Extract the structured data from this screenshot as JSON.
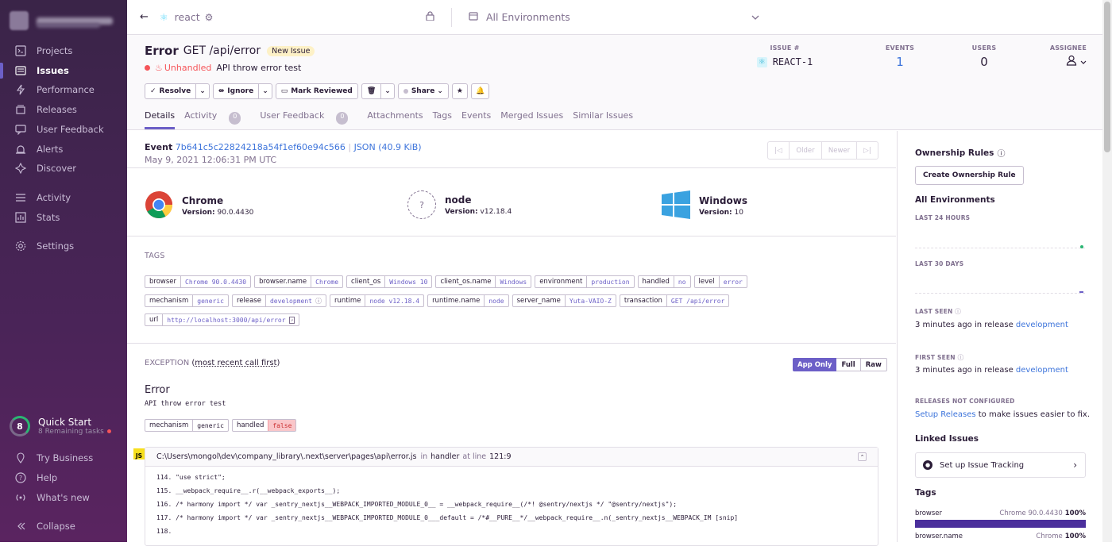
{
  "sidebar": {
    "items": [
      {
        "label": "Projects",
        "icon": "projects-icon"
      },
      {
        "label": "Issues",
        "icon": "issues-icon",
        "active": true
      },
      {
        "label": "Performance",
        "icon": "performance-icon"
      },
      {
        "label": "Releases",
        "icon": "releases-icon"
      },
      {
        "label": "User Feedback",
        "icon": "user-feedback-icon"
      },
      {
        "label": "Alerts",
        "icon": "alerts-icon"
      },
      {
        "label": "Discover",
        "icon": "discover-icon"
      },
      {
        "label": "Activity",
        "icon": "activity-icon"
      },
      {
        "label": "Stats",
        "icon": "stats-icon"
      },
      {
        "label": "Settings",
        "icon": "settings-icon"
      }
    ],
    "quick_start": {
      "count": "8",
      "title": "Quick Start",
      "subtitle": "8 Remaining tasks"
    },
    "bottom": [
      {
        "label": "Try Business"
      },
      {
        "label": "Help"
      },
      {
        "label": "What's new"
      },
      {
        "label": "Collapse"
      }
    ]
  },
  "topbar": {
    "project": "react",
    "environment": "All Environments"
  },
  "issue": {
    "level": "Error",
    "title": "GET /api/error",
    "badge": "New Issue",
    "unhandled": "Unhandled",
    "message": "API throw error test",
    "issue_label": "ISSUE #",
    "issue_id": "REACT-1",
    "events_label": "EVENTS",
    "events": "1",
    "users_label": "USERS",
    "users": "0",
    "assignee_label": "ASSIGNEE"
  },
  "actions": {
    "resolve": "Resolve",
    "ignore": "Ignore",
    "mark_reviewed": "Mark Reviewed",
    "share": "Share"
  },
  "tabs": {
    "details": "Details",
    "activity": "Activity",
    "activity_count": "0",
    "user_feedback": "User Feedback",
    "uf_count": "0",
    "attachments": "Attachments",
    "tags": "Tags",
    "events": "Events",
    "merged": "Merged Issues",
    "similar": "Similar Issues"
  },
  "event": {
    "label": "Event",
    "id": "7b641c5c22824218a54f1ef60e94c566",
    "json": "JSON (40.9 KiB)",
    "date": "May 9, 2021 12:06:31 PM UTC",
    "older": "Older",
    "newer": "Newer"
  },
  "contexts": [
    {
      "name": "Chrome",
      "version_label": "Version:",
      "version": "90.0.4430"
    },
    {
      "name": "node",
      "version_label": "Version:",
      "version": "v12.18.4"
    },
    {
      "name": "Windows",
      "version_label": "Version:",
      "version": "10"
    }
  ],
  "tags_title": "TAGS",
  "tags": [
    {
      "k": "browser",
      "v": "Chrome 90.0.4430"
    },
    {
      "k": "browser.name",
      "v": "Chrome"
    },
    {
      "k": "client_os",
      "v": "Windows 10"
    },
    {
      "k": "client_os.name",
      "v": "Windows"
    },
    {
      "k": "environment",
      "v": "production"
    },
    {
      "k": "handled",
      "v": "no"
    },
    {
      "k": "level",
      "v": "error"
    },
    {
      "k": "mechanism",
      "v": "generic"
    },
    {
      "k": "release",
      "v": "development"
    },
    {
      "k": "runtime",
      "v": "node v12.18.4"
    },
    {
      "k": "runtime.name",
      "v": "node"
    },
    {
      "k": "server_name",
      "v": "Yuta-VAIO-Z"
    },
    {
      "k": "transaction",
      "v": "GET /api/error"
    },
    {
      "k": "url",
      "v": "http://localhost:3000/api/error"
    }
  ],
  "exception": {
    "title": "EXCEPTION",
    "subtitle": "most recent call first",
    "app_only": "App Only",
    "full": "Full",
    "raw": "Raw",
    "type": "Error",
    "value": "API throw error test",
    "mech_tags": [
      {
        "k": "mechanism",
        "v": "generic"
      },
      {
        "k": "handled",
        "v": "false"
      }
    ],
    "file": "C:\\Users\\mongol\\dev\\company_library\\.next\\server\\pages\\api\\error.js",
    "in": "in",
    "func": "handler",
    "at_line": "at line",
    "line": "121:9",
    "lines": [
      "114. \"use strict\";",
      "115. __webpack_require__.r(__webpack_exports__);",
      "116. /* harmony import */ var _sentry_nextjs__WEBPACK_IMPORTED_MODULE_0__ = __webpack_require__(/*! @sentry/nextjs */ \"@sentry/nextjs\");",
      "117. /* harmony import */ var _sentry_nextjs__WEBPACK_IMPORTED_MODULE_0___default = /*#__PURE__*/__webpack_require__.n(_sentry_nextjs__WEBPACK_IM [snip]",
      "118."
    ]
  },
  "right": {
    "ownership": "Ownership Rules",
    "create_rule": "Create Ownership Rule",
    "all_env": "All Environments",
    "last24": "LAST 24 HOURS",
    "last30": "LAST 30 DAYS",
    "last_seen": "LAST SEEN",
    "last_seen_text": "3 minutes ago in release",
    "last_seen_rel": "development",
    "first_seen": "FIRST SEEN",
    "first_seen_text": "3 minutes ago in release",
    "first_seen_rel": "development",
    "releases_nc": "RELEASES NOT CONFIGURED",
    "setup_releases": "Setup Releases",
    "setup_text": "to make issues easier to fix.",
    "linked": "Linked Issues",
    "setup_tracking": "Set up Issue Tracking",
    "tags": "Tags",
    "tag1_name": "browser",
    "tag1_val": "Chrome 90.0.4430",
    "tag1_pct": "100%",
    "tag2_name": "browser.name",
    "tag2_val": "Chrome",
    "tag2_pct": "100%"
  },
  "colors": {
    "accent": "#6c5fc7",
    "link": "#3d74db",
    "error": "#f55459"
  }
}
